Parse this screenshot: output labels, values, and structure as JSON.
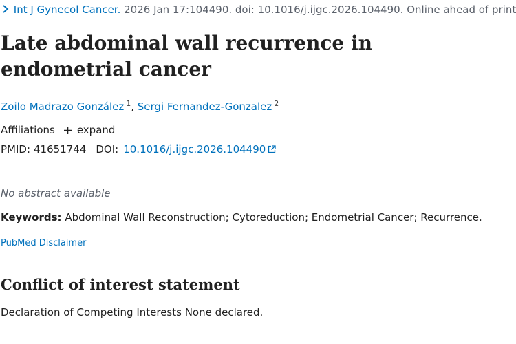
{
  "citation": {
    "journal": "Int J Gynecol Cancer.",
    "details": " 2026 Jan 17:104490. doi: 10.1016/j.ijgc.2026.104490. Online ahead of print."
  },
  "article": {
    "title": "Late abdominal wall recurrence in endometrial cancer"
  },
  "authors": [
    {
      "name": "Zoilo Madrazo González",
      "affiliation_ref": "1"
    },
    {
      "name": "Sergi Fernandez-Gonzalez",
      "affiliation_ref": "2"
    }
  ],
  "affiliations": {
    "label": "Affiliations",
    "toggle_label": "expand"
  },
  "identifiers": {
    "pmid_label": "PMID:",
    "pmid": "41651744",
    "doi_label": "DOI:",
    "doi": "10.1016/j.ijgc.2026.104490"
  },
  "abstract": {
    "no_abstract_text": "No abstract available"
  },
  "keywords": {
    "label": "Keywords:",
    "text": "Abdominal Wall Reconstruction; Cytoreduction; Endometrial Cancer; Recurrence."
  },
  "disclaimer": {
    "link_text": "PubMed Disclaimer"
  },
  "conflict_of_interest": {
    "heading": "Conflict of interest statement",
    "text": "Declaration of Competing Interests None declared."
  },
  "colors": {
    "link": "#0071bc",
    "text": "#212121",
    "muted": "#5b616b"
  }
}
